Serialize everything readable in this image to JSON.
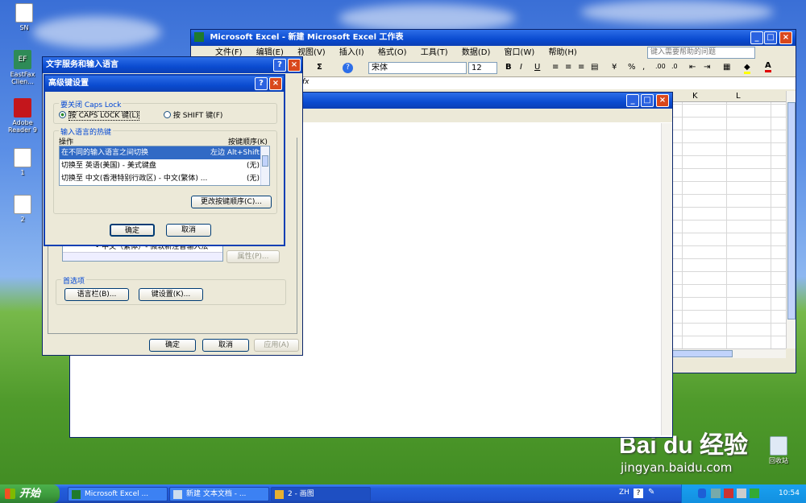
{
  "desktop": {
    "icons": [
      {
        "label": "SN"
      },
      {
        "label": "EastFax Clien..."
      },
      {
        "label": "Adobe Reader 9"
      },
      {
        "label": "1"
      },
      {
        "label": "2"
      },
      {
        "label": "回收站"
      }
    ],
    "watermark": {
      "brand": "Bai du 经验",
      "url": "jingyan.baidu.com"
    }
  },
  "excel": {
    "title": "Microsoft Excel - 新建 Microsoft Excel 工作表",
    "menu": [
      "文件(F)",
      "编辑(E)",
      "视图(V)",
      "插入(I)",
      "格式(O)",
      "工具(T)",
      "数据(D)",
      "窗口(W)",
      "帮助(H)"
    ],
    "help_placeholder": "键入需要帮助的问题",
    "font_name": "宋体",
    "font_size": "12",
    "columns": [
      "K",
      "L"
    ],
    "fx": "fx"
  },
  "text_services": {
    "title": "文字服务和输入语言",
    "list_item": "• 中文（繁体）- 微软新注音输入法",
    "properties_button": "属性(P)...",
    "preferences_label": "首选项",
    "language_bar_button": "语言栏(B)...",
    "key_settings_button": "键设置(K)...",
    "ok": "确定",
    "cancel": "取消",
    "apply": "应用(A)"
  },
  "advanced_keys": {
    "title": "高级键设置",
    "caps_group": "要关闭 Caps Lock",
    "radio_caps": "按 CAPS LOCK 键(L)",
    "radio_shift": "按 SHIFT 键(F)",
    "hotkey_group": "输入语言的热键",
    "col_action": "操作",
    "col_sequence": "按键顺序(K)",
    "rows": [
      {
        "action": "在不同的输入语言之间切换",
        "seq": "左边 Alt+Shift"
      },
      {
        "action": "切换至 英语(美国) - 美式键盘",
        "seq": "(无)"
      },
      {
        "action": "切换至 中文(香港特别行政区) - 中文(繁体) ...",
        "seq": "(无)"
      }
    ],
    "change_sequence_button": "更改按键顺序(C)...",
    "ok": "确定",
    "cancel": "取消"
  },
  "taskbar": {
    "start": "开始",
    "items": [
      "Microsoft Excel ...",
      "新建 文本文档 - ...",
      "2 - 画图"
    ],
    "lang": "ZH",
    "clock": "10:54"
  },
  "colors": {
    "titlebar": "#0a4bd0",
    "dialog_bg": "#ece9d8",
    "selection": "#316ac5",
    "start": "#3c9a3c"
  }
}
